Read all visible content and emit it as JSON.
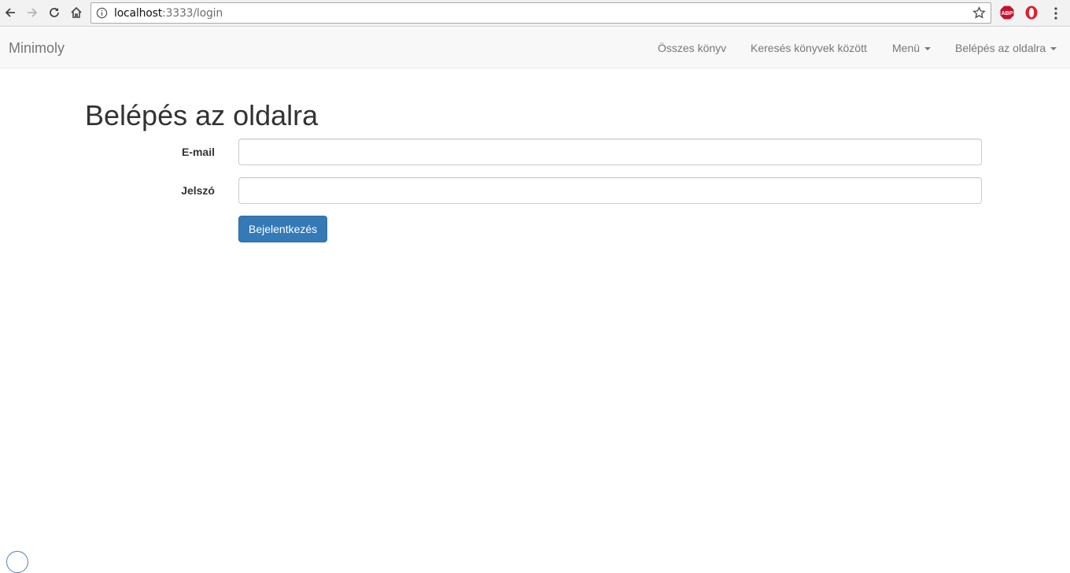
{
  "browser": {
    "url_host": "localhost",
    "url_rest": ":3333/login",
    "icons": [
      "back-arrow-icon",
      "forward-arrow-icon",
      "reload-icon",
      "home-icon",
      "info-icon",
      "bookmark-star-icon",
      "adblock-icon",
      "opera-icon",
      "more-vert-icon"
    ],
    "adblock_label": "ABP"
  },
  "navbar": {
    "brand": "Minimoly",
    "items": [
      {
        "label": "Összes könyv"
      },
      {
        "label": "Keresés könyvek között"
      },
      {
        "label": "Menü",
        "dropdown": true
      },
      {
        "label": "Belépés az oldalra",
        "dropdown": true
      }
    ]
  },
  "page": {
    "title": "Belépés az oldalra",
    "form": {
      "email_label": "E-mail",
      "email_value": "",
      "password_label": "Jelszó",
      "password_value": "",
      "submit_label": "Bejelentkezés"
    }
  },
  "colors": {
    "primary": "#337ab7",
    "navbar_bg": "#f8f8f8",
    "nav_text": "#777777"
  }
}
